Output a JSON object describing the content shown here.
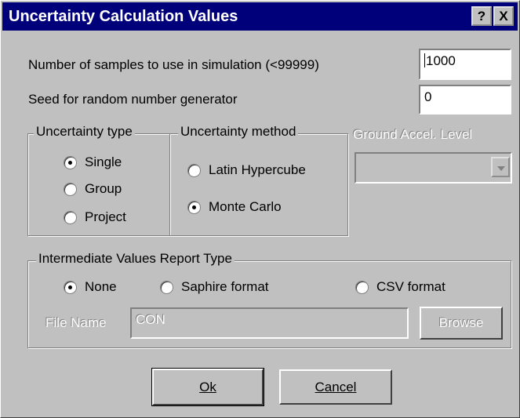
{
  "window": {
    "title": "Uncertainty Calculation Values",
    "help_button": "?",
    "close_button": "X"
  },
  "samples": {
    "label": "Number of samples to use in simulation (<99999)",
    "value": "1000"
  },
  "seed": {
    "label": "Seed for random number generator",
    "value": "0"
  },
  "uncertainty_type": {
    "legend": "Uncertainty type",
    "options": [
      "Single",
      "Group",
      "Project"
    ],
    "selected": "Single"
  },
  "uncertainty_method": {
    "legend": "Uncertainty method",
    "options": [
      "Latin Hypercube",
      "Monte Carlo"
    ],
    "selected": "Monte Carlo"
  },
  "ground_accel": {
    "legend": "Ground Accel. Level",
    "value": "",
    "enabled": false
  },
  "report_type": {
    "legend": "Intermediate Values Report Type",
    "options": [
      "None",
      "Saphire format",
      "CSV format"
    ],
    "selected": "None"
  },
  "file_name": {
    "label": "File Name",
    "value": "CON",
    "browse_label": "Browse",
    "enabled": false
  },
  "buttons": {
    "ok": "Ok",
    "cancel": "Cancel"
  },
  "colors": {
    "titlebar": "#00007b",
    "face": "#c0c0c0"
  }
}
